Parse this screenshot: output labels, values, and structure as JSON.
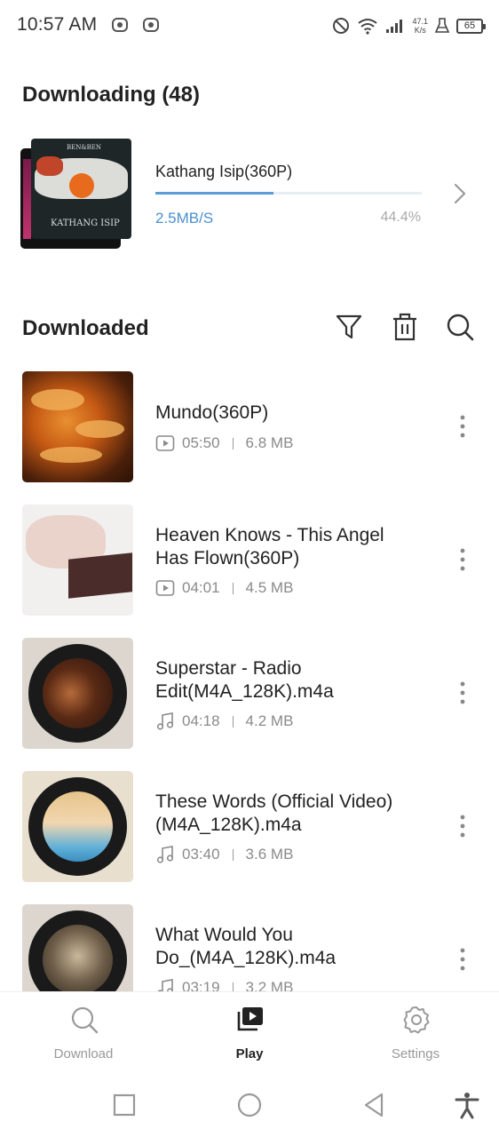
{
  "status_bar": {
    "time": "10:57 AM",
    "net_speed_value": "47.1",
    "net_speed_unit": "K/s",
    "battery": "65",
    "icons": [
      "notification-icon",
      "notification-icon",
      "dnd-icon",
      "wifi-icon",
      "signal-icon",
      "flask-icon",
      "battery-icon"
    ]
  },
  "downloading": {
    "title": "Downloading (48)",
    "item": {
      "name": "Kathang Isip(360P)",
      "speed": "2.5MB/S",
      "percent": "44.4%",
      "progress": 0.444,
      "thumb_text_top": "BEN&BEN",
      "thumb_text_bottom": "KATHANG ISIP"
    }
  },
  "downloaded": {
    "title": "Downloaded",
    "actions": [
      "filter-icon",
      "delete-icon",
      "search-icon"
    ],
    "items": [
      {
        "title_line1": "Mundo(360P)",
        "title_line2": "",
        "type": "video",
        "duration": "05:50",
        "size": "6.8 MB"
      },
      {
        "title_line1": "Heaven Knows - This Angel",
        "title_line2": "Has Flown(360P)",
        "type": "video",
        "duration": "04:01",
        "size": "4.5 MB"
      },
      {
        "title_line1": "Superstar - Radio",
        "title_line2": "Edit(M4A_128K).m4a",
        "type": "audio",
        "duration": "04:18",
        "size": "4.2 MB"
      },
      {
        "title_line1": "These Words (Official Video)",
        "title_line2": "(M4A_128K).m4a",
        "type": "audio",
        "duration": "03:40",
        "size": "3.6 MB"
      },
      {
        "title_line1": "What Would You",
        "title_line2": "Do_(M4A_128K).m4a",
        "type": "audio",
        "duration": "03:19",
        "size": "3.2 MB"
      }
    ]
  },
  "bottom_nav": {
    "items": [
      {
        "label": "Download",
        "icon": "search-icon",
        "active": false
      },
      {
        "label": "Play",
        "icon": "play-library-icon",
        "active": true
      },
      {
        "label": "Settings",
        "icon": "gear-icon",
        "active": false
      }
    ]
  },
  "colors": {
    "accent": "#4b8fd0",
    "progress_track": "#e6edf3",
    "text_primary": "#222222",
    "text_secondary": "#8a8a8a"
  }
}
